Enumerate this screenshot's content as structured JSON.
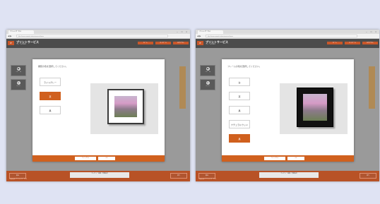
{
  "colors": {
    "background": "#dfe3f3",
    "accent": "#d0601e",
    "app_bar": "#4c4c4c"
  },
  "screens": [
    {
      "tab_title": "プリントサービス",
      "url": "http://www.example.jp/printservice/frame",
      "app_title": "プリントサービス",
      "app_subtitle": "フレームを選ぶ",
      "header_buttons": [
        "カート",
        "マイページ",
        "ログアウト"
      ],
      "side_buttons": [
        "フレーム",
        "マット"
      ],
      "prompt": "額装の色を選択してください。",
      "options": [
        "ライトグレー",
        "茶",
        "黒"
      ],
      "selected_option": 1,
      "cancel_label": "キャンセル",
      "ok_label": "OK",
      "bottom_left": "戻る",
      "bottom_center": "プレビュー画面 / 詳細設定",
      "bottom_right": "次へ",
      "footer_note": "Copyright プリントサービス"
    },
    {
      "tab_title": "プリントサービス",
      "url": "http://www.example.jp/printservice/frame",
      "app_title": "プリントサービス",
      "app_subtitle": "フレームを選ぶ",
      "header_buttons": [
        "カート",
        "マイページ",
        "ログアウト"
      ],
      "side_buttons": [
        "フレーム",
        "マット"
      ],
      "prompt": "フレームの色を選択してください。",
      "options": [
        "白",
        "茶",
        "黒",
        "ナチュラルウッド",
        "黒"
      ],
      "selected_option": 4,
      "cancel_label": "キャンセル",
      "ok_label": "OK",
      "bottom_left": "戻る",
      "bottom_center": "プレビュー画面 / 詳細設定",
      "bottom_right": "次へ",
      "footer_note": "Copyright プリントサービス"
    }
  ]
}
